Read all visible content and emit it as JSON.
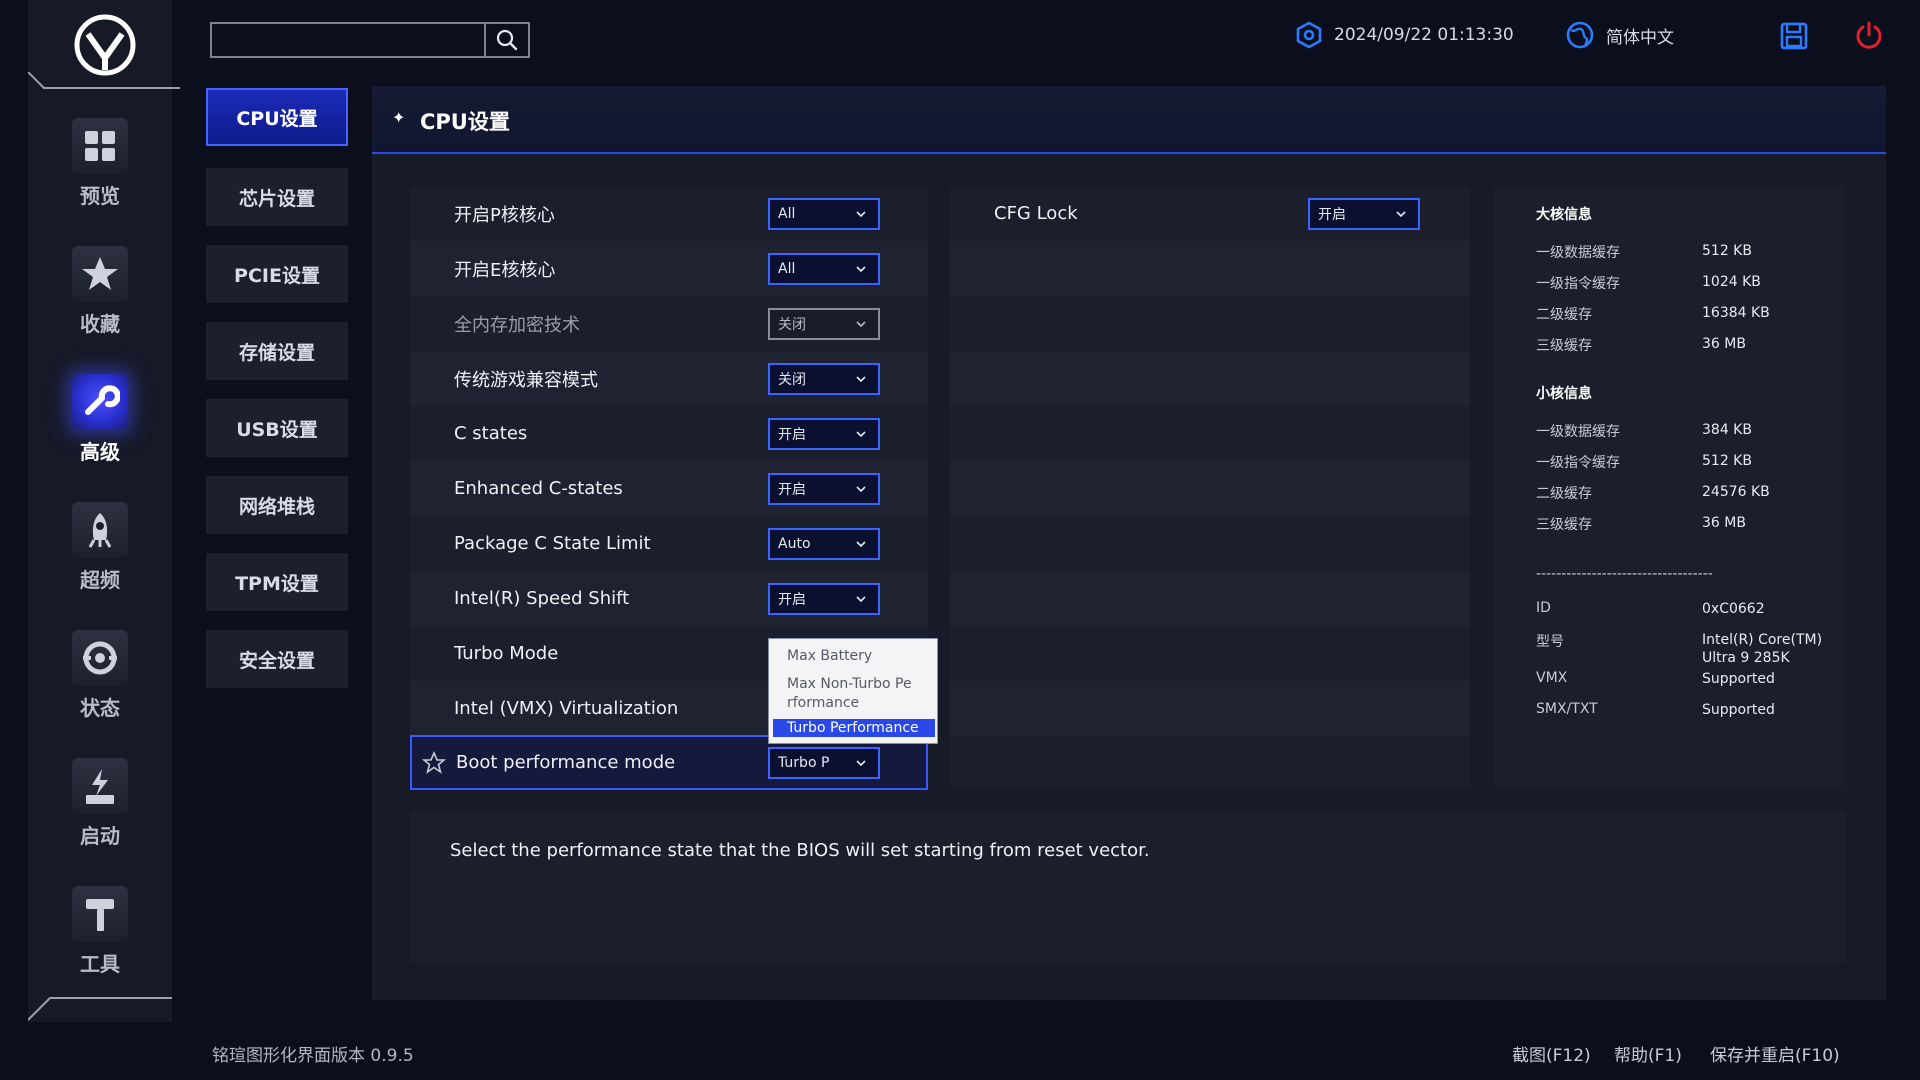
{
  "nav": {
    "items": [
      {
        "label": "预览",
        "icon": "grid-icon"
      },
      {
        "label": "收藏",
        "icon": "star-icon"
      },
      {
        "label": "高级",
        "icon": "wrench-icon",
        "active": true
      },
      {
        "label": "超频",
        "icon": "rocket-icon"
      },
      {
        "label": "状态",
        "icon": "status-icon"
      },
      {
        "label": "启动",
        "icon": "ssd-icon"
      },
      {
        "label": "工具",
        "icon": "hammer-icon"
      }
    ]
  },
  "search": {
    "value": "",
    "placeholder": ""
  },
  "topbar": {
    "datetime": "2024/09/22 01:13:30",
    "language": "简体中文",
    "save_icon": "save-icon",
    "power_icon": "power-icon",
    "accent": "#3b63ff",
    "power_color": "#e0202a"
  },
  "categories": [
    {
      "label": "CPU设置",
      "active": true
    },
    {
      "label": "芯片设置"
    },
    {
      "label": "PCIE设置"
    },
    {
      "label": "存储设置"
    },
    {
      "label": "USB设置"
    },
    {
      "label": "网络堆栈"
    },
    {
      "label": "TPM设置"
    },
    {
      "label": "安全设置"
    }
  ],
  "main": {
    "title": "CPU设置"
  },
  "settings_left": [
    {
      "label": "开启P核核心",
      "value": "All"
    },
    {
      "label": "开启E核核心",
      "value": "All"
    },
    {
      "label": "全内存加密技术",
      "value": "关闭",
      "disabled": true
    },
    {
      "label": "传统游戏兼容模式",
      "value": "关闭"
    },
    {
      "label": "C states",
      "value": "开启"
    },
    {
      "label": "Enhanced C-states",
      "value": "开启"
    },
    {
      "label": "Package C State Limit",
      "value": "Auto"
    },
    {
      "label": "Intel(R) Speed Shift",
      "value": "开启"
    },
    {
      "label": "Turbo Mode",
      "value": ""
    },
    {
      "label": "Intel (VMX) Virtualization",
      "value": ""
    },
    {
      "label": "Boot performance mode",
      "value": "Turbo P",
      "selected": true
    }
  ],
  "settings_right": [
    {
      "label": "CFG Lock",
      "value": "开启"
    }
  ],
  "dropdown_popup": {
    "options": [
      "Max Battery",
      "Max Non-Turbo Pe",
      "rformance",
      "Turbo Performance"
    ]
  },
  "info": {
    "big_core_title": "大核信息",
    "big_core": [
      {
        "k": "一级数据缓存",
        "v": "512 KB"
      },
      {
        "k": "一级指令缓存",
        "v": "1024 KB"
      },
      {
        "k": "二级缓存",
        "v": "16384 KB"
      },
      {
        "k": "三级缓存",
        "v": "36 MB"
      }
    ],
    "small_core_title": "小核信息",
    "small_core": [
      {
        "k": "一级数据缓存",
        "v": "384 KB"
      },
      {
        "k": "一级指令缓存",
        "v": "512 KB"
      },
      {
        "k": "二级缓存",
        "v": "24576 KB"
      },
      {
        "k": "三级缓存",
        "v": "36 MB"
      }
    ],
    "divider": "-----------------------------------",
    "cpu": [
      {
        "k": "ID",
        "v": "0xC0662"
      },
      {
        "k": "型号",
        "v": "Intel(R) Core(TM) Ultra 9 285K"
      },
      {
        "k": "VMX",
        "v": "Supported"
      },
      {
        "k": "SMX/TXT",
        "v": "Supported"
      }
    ]
  },
  "description": "Select the performance state that the BIOS will set starting from reset vector.",
  "footer": {
    "version": "铭瑄图形化界面版本 0.9.5",
    "screenshot": "截图(F12)",
    "help": "帮助(F1)",
    "save_restart": "保存并重启(F10)"
  }
}
